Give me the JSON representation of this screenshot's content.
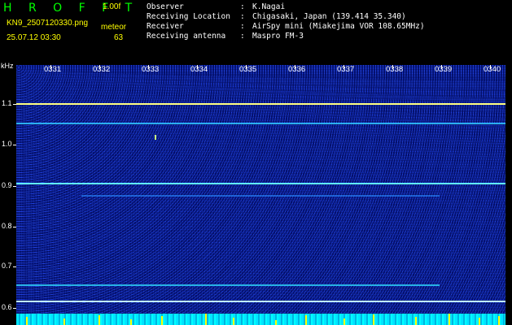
{
  "header": {
    "app_title": "H R O F F T",
    "version": "1.00f",
    "filename": "KN9_2507120330.png",
    "datetime": "25.07.12 03:30",
    "meteor_label": "meteor",
    "meteor_count": "63"
  },
  "info": [
    {
      "key": "Observer",
      "value": "K.Nagai"
    },
    {
      "key": "Receiving Location",
      "value": "Chigasaki, Japan (139.414 35.340)"
    },
    {
      "key": "Receiver",
      "value": "AirSpy mini (Miakejima VOR 108.65MHz)"
    },
    {
      "key": "Receiving antenna",
      "value": "Maspro FM-3"
    }
  ],
  "axis": {
    "y_unit": "kHz",
    "y_ticks": [
      "1.1",
      "1.0",
      "0.9",
      "0.8",
      "0.7",
      "0.6"
    ],
    "time_ticks": [
      "0331",
      "0332",
      "0333",
      "0334",
      "0335",
      "0336",
      "0337",
      "0338",
      "0339",
      "0340"
    ]
  },
  "colors": {
    "accent_green": "#00ff00",
    "label_yellow": "#ffff00",
    "plot_blue": "#04127a",
    "echo_cyan": "#40e0ff"
  }
}
